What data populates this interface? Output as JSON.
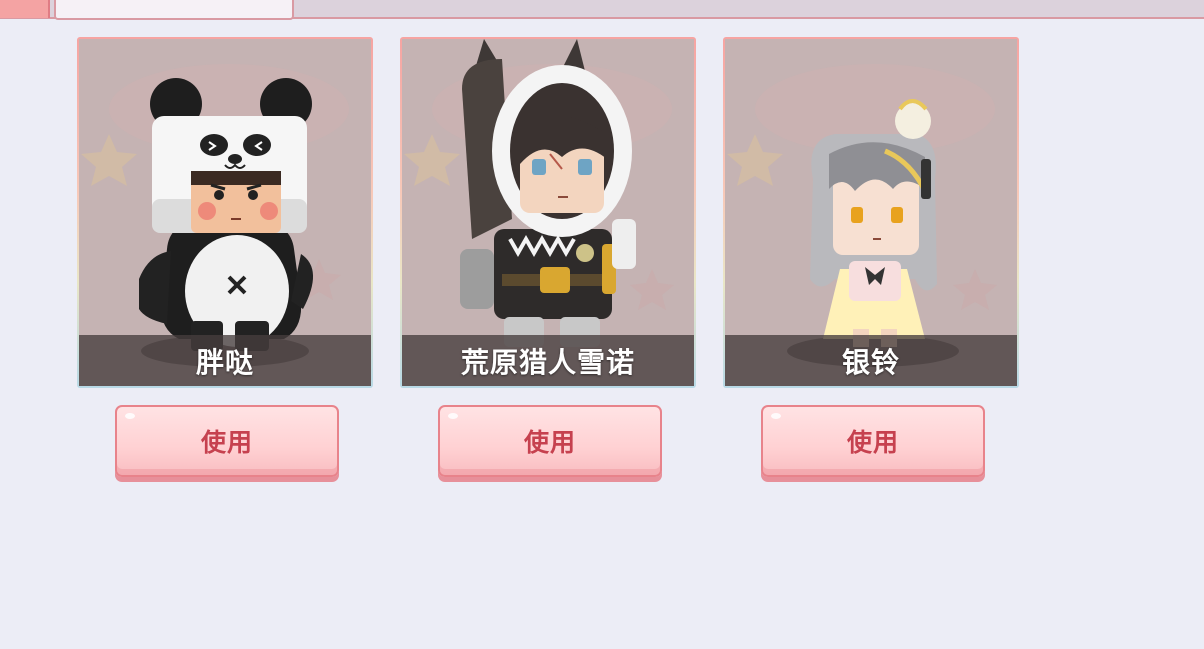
{
  "top_tab": {
    "label": ""
  },
  "skins": [
    {
      "name": "胖哒",
      "button_label": "使用",
      "figure": "panda-character-icon"
    },
    {
      "name": "荒原猎人雪诺",
      "button_label": "使用",
      "figure": "hunter-character-icon"
    },
    {
      "name": "银铃",
      "button_label": "使用",
      "figure": "girl-character-icon"
    }
  ],
  "colors": {
    "page_bg": "#ecedf6",
    "card_bg": "#c5b3b3",
    "name_bar": "#463e3e",
    "button_fill": "#ffd1d3",
    "button_border": "#e8838b",
    "button_text": "#c6414f"
  }
}
